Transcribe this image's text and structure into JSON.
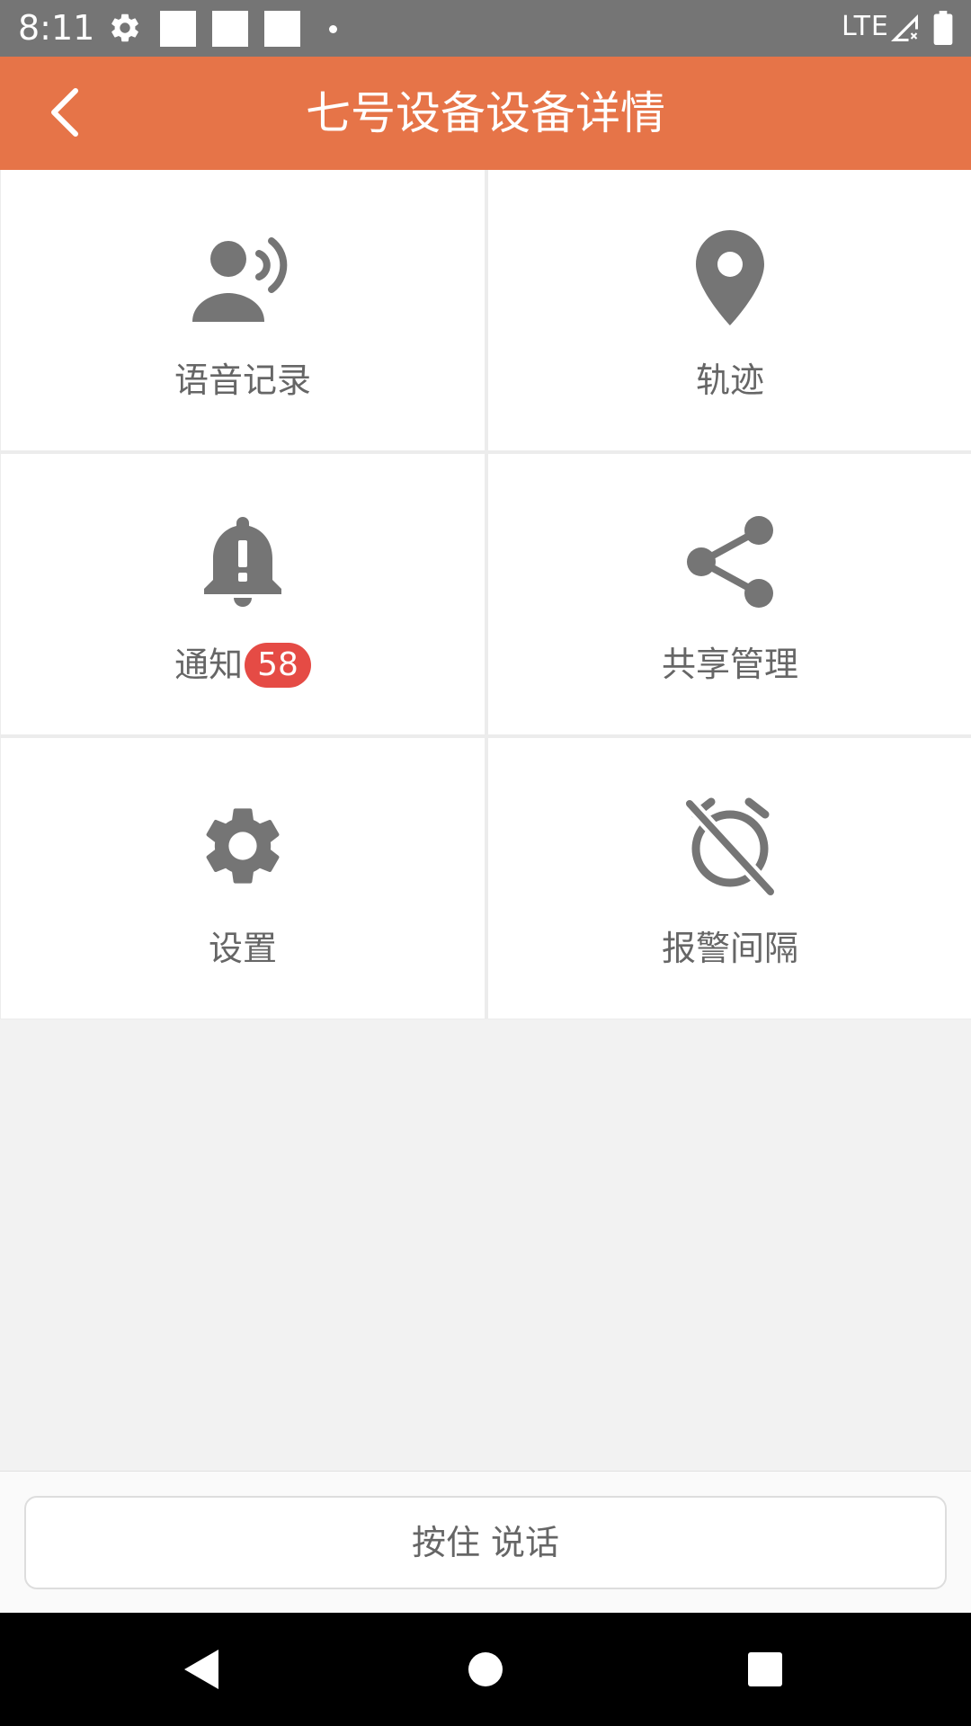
{
  "status_bar": {
    "time": "8:11",
    "network": "LTE",
    "icons": [
      "gear-icon",
      "notification-square-icon",
      "notification-square-icon",
      "notification-square-icon",
      "dot-icon",
      "signal-icon",
      "battery-icon"
    ]
  },
  "app_bar": {
    "title": "七号设备设备详情",
    "back_icon": "chevron-left-icon",
    "color": "#e67448"
  },
  "tiles": [
    {
      "label": "语音记录",
      "icon": "voice-record-icon"
    },
    {
      "label": "轨迹",
      "icon": "location-pin-icon"
    },
    {
      "label": "通知",
      "icon": "bell-alert-icon",
      "badge": "58"
    },
    {
      "label": "共享管理",
      "icon": "share-icon"
    },
    {
      "label": "设置",
      "icon": "gear-icon"
    },
    {
      "label": "报警间隔",
      "icon": "alarm-off-icon"
    }
  ],
  "talk_button": {
    "label": "按住 说话"
  },
  "colors": {
    "accent": "#e67448",
    "badge": "#e54b45",
    "icon": "#757575",
    "text": "#666666"
  },
  "nav_bar": {
    "icons": [
      "back-triangle-icon",
      "home-circle-icon",
      "recents-square-icon"
    ]
  }
}
